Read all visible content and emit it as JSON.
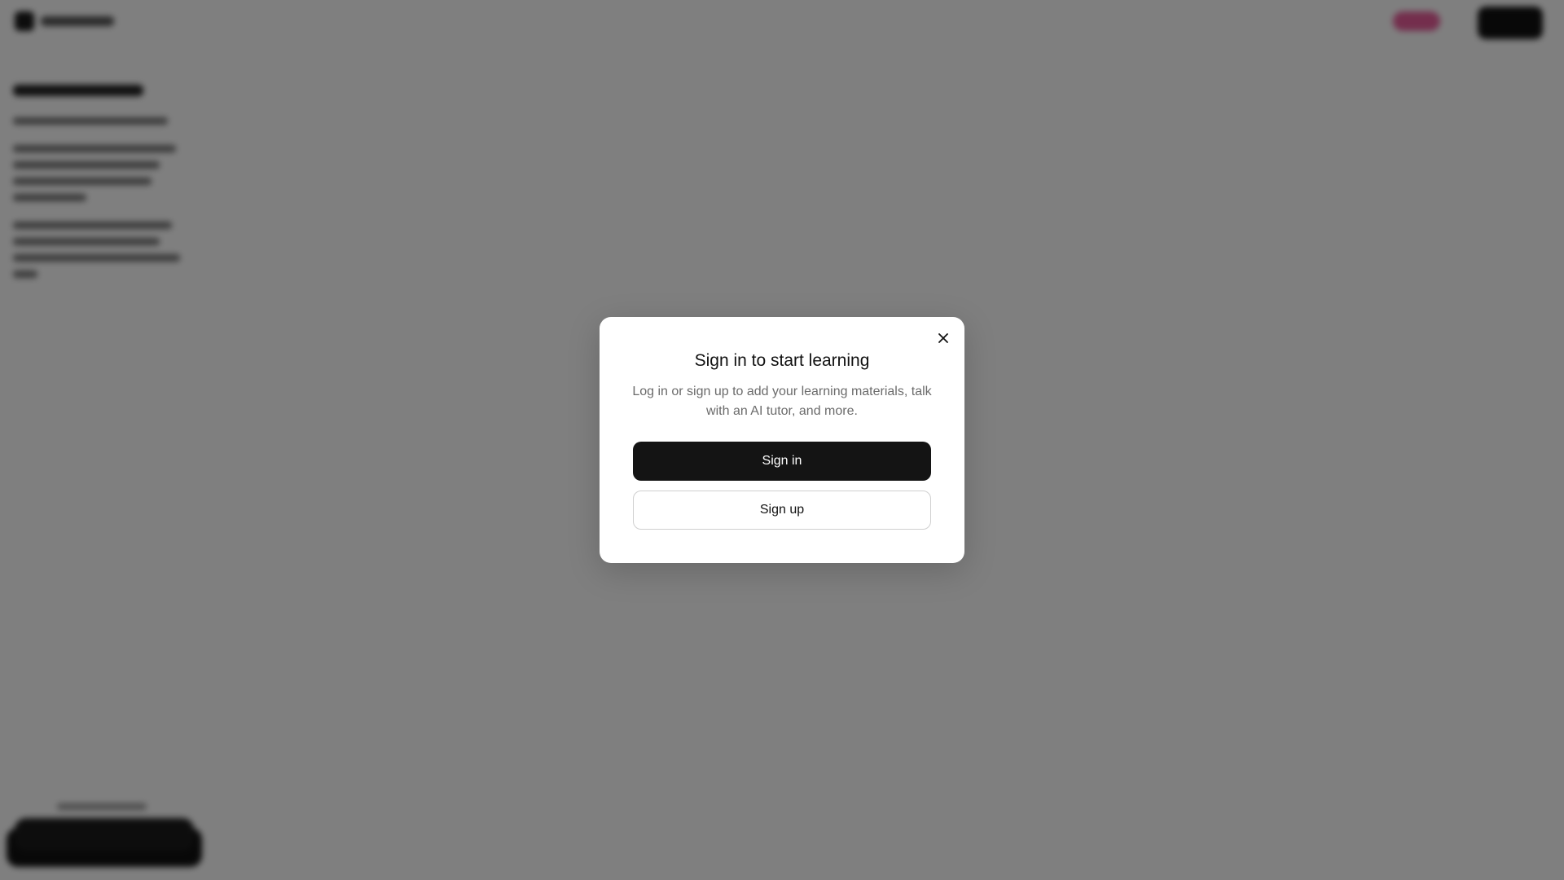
{
  "modal": {
    "title": "Sign in to start learning",
    "description": "Log in or sign up to add your learning materials, talk with an AI tutor, and more.",
    "sign_in_label": "Sign in",
    "sign_up_label": "Sign up",
    "close_icon": "close-icon"
  },
  "colors": {
    "overlay": "#808080",
    "primary_button": "#141414",
    "modal_background": "#ffffff",
    "accent_pink": "#e85d9a"
  }
}
